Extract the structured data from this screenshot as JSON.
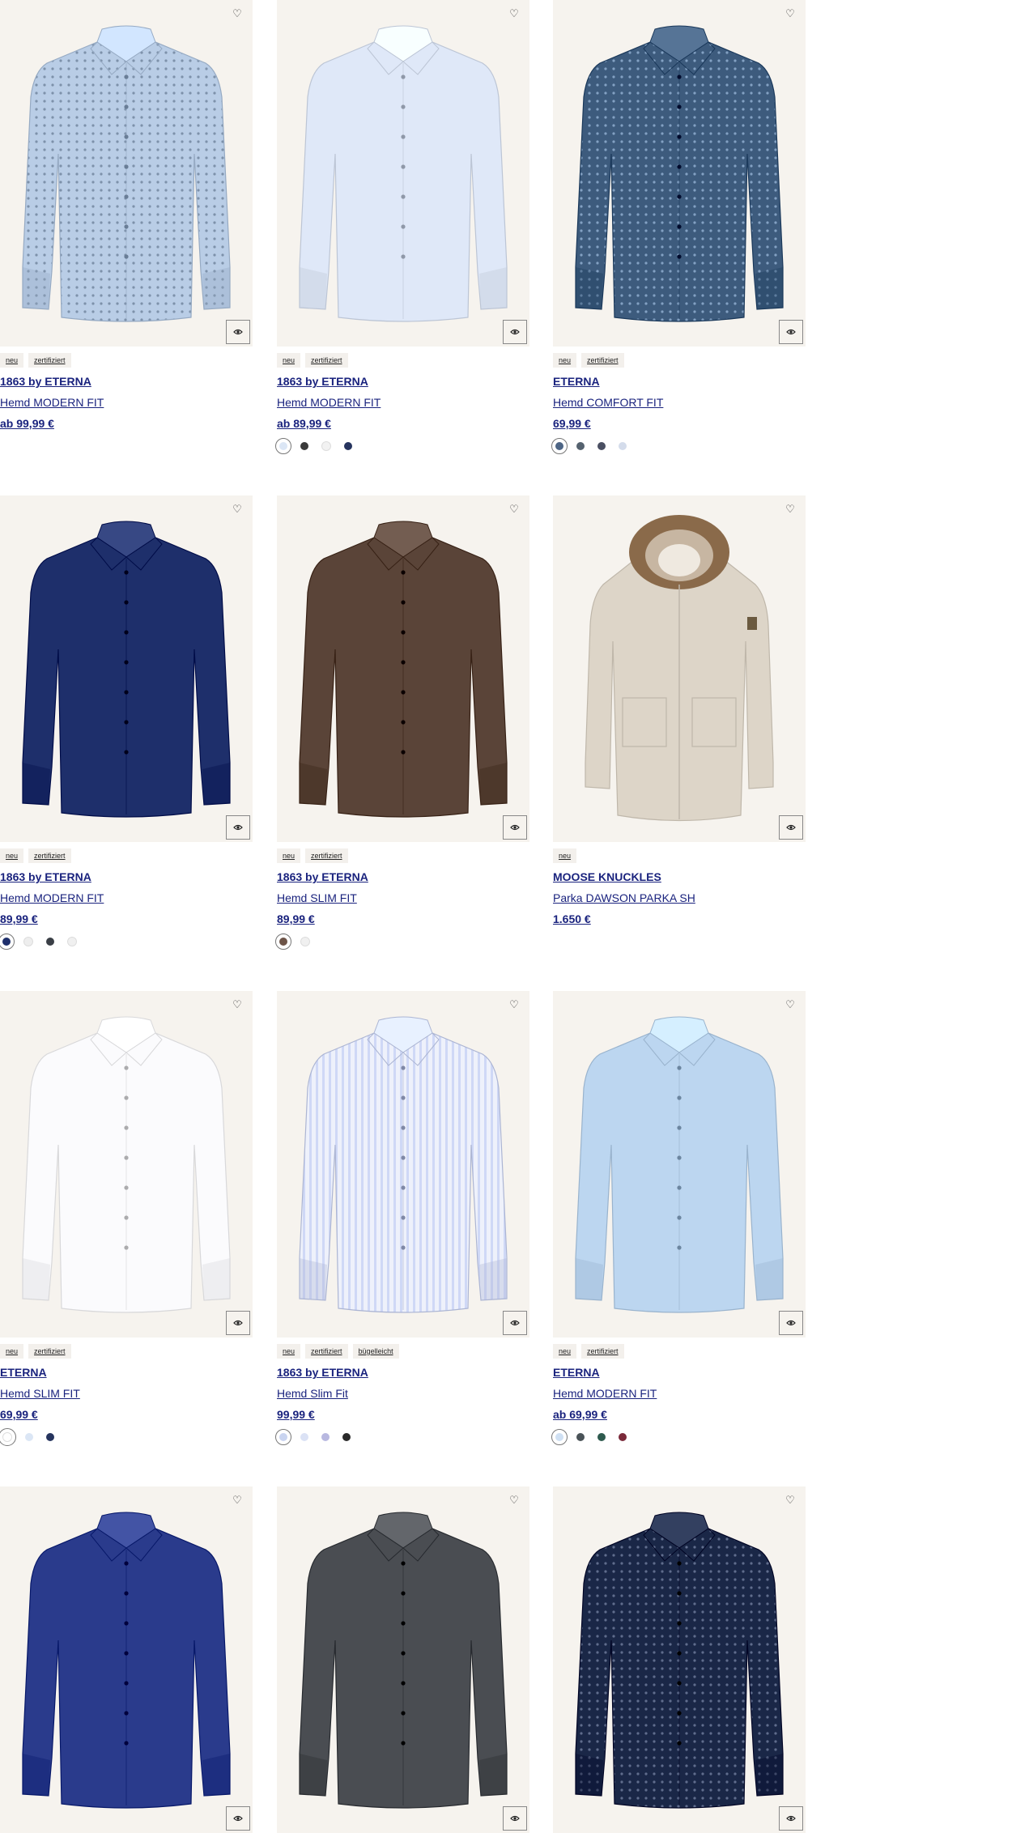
{
  "products": [
    {
      "badges": [
        "neu",
        "zertifiziert"
      ],
      "brand": "1863 by ETERNA",
      "name": "Hemd MODERN FIT",
      "price": "ab 99,99 €",
      "type": "shirt",
      "color": "#b9cde6",
      "pattern": "dots",
      "swatches": []
    },
    {
      "badges": [
        "neu",
        "zertifiziert"
      ],
      "brand": "1863 by ETERNA",
      "name": "Hemd MODERN FIT",
      "price": "ab 89,99 €",
      "type": "shirt",
      "color": "#dfe8f8",
      "pattern": "plain",
      "swatches": [
        "#dbe6f5",
        "#3a3a3a",
        "#f2f2f2",
        "#26345e"
      ]
    },
    {
      "badges": [
        "neu",
        "zertifiziert"
      ],
      "brand": "ETERNA",
      "name": "Hemd COMFORT FIT",
      "price": "69,99 €",
      "type": "shirt",
      "color": "#3d5b7d",
      "pattern": "dots",
      "swatches": [
        "#4d6585",
        "#55626f",
        "#4a4f62",
        "#d4dceb"
      ]
    },
    {
      "badges": [
        "neu",
        "zertifiziert"
      ],
      "brand": "1863 by ETERNA",
      "name": "Hemd MODERN FIT",
      "price": "89,99 €",
      "type": "shirt",
      "color": "#1e2f6b",
      "pattern": "plain",
      "swatches": [
        "#1e2f6b",
        "#eeeeee",
        "#3a3f46",
        "#f0f0f0"
      ]
    },
    {
      "badges": [
        "neu",
        "zertifiziert"
      ],
      "brand": "1863 by ETERNA",
      "name": "Hemd SLIM FIT",
      "price": "89,99 €",
      "type": "shirt",
      "color": "#5a4438",
      "pattern": "plain",
      "swatches": [
        "#6d5448",
        "#f0f0f0"
      ]
    },
    {
      "badges": [
        "neu"
      ],
      "brand": "MOOSE KNUCKLES",
      "name": "Parka DAWSON PARKA SH",
      "price": "1.650 €",
      "type": "parka",
      "color": "#ddd5c8",
      "pattern": "plain",
      "swatches": []
    },
    {
      "badges": [
        "neu",
        "zertifiziert"
      ],
      "brand": "ETERNA",
      "name": "Hemd SLIM FIT",
      "price": "69,99 €",
      "type": "shirt",
      "color": "#fbfbfd",
      "pattern": "plain",
      "swatches": [
        "#ffffff",
        "#dbe6f5",
        "#26345e"
      ]
    },
    {
      "badges": [
        "neu",
        "zertifiziert",
        "bügelleicht"
      ],
      "brand": "1863 by ETERNA",
      "name": "Hemd Slim Fit",
      "price": "99,99 €",
      "type": "shirt",
      "color": "#cfd8f6",
      "pattern": "stripes",
      "swatches": [
        "#c9d4f0",
        "#dbe2f5",
        "#b8b8e0",
        "#2a2a2a"
      ]
    },
    {
      "badges": [
        "neu",
        "zertifiziert"
      ],
      "brand": "ETERNA",
      "name": "Hemd MODERN FIT",
      "price": "ab 69,99 €",
      "type": "shirt",
      "color": "#bcd6f0",
      "pattern": "plain",
      "swatches": [
        "#cfe0f3",
        "#4a5358",
        "#2e5a4e",
        "#7a2a3a"
      ]
    },
    {
      "badges": [],
      "brand": "",
      "name": "",
      "price": "",
      "type": "shirt",
      "color": "#2a3b8c",
      "pattern": "plain",
      "swatches": []
    },
    {
      "badges": [],
      "brand": "",
      "name": "",
      "price": "",
      "type": "shirt",
      "color": "#4a4d52",
      "pattern": "plain",
      "swatches": []
    },
    {
      "badges": [],
      "brand": "",
      "name": "",
      "price": "",
      "type": "shirt",
      "color": "#1a2747",
      "pattern": "dots",
      "swatches": []
    }
  ]
}
